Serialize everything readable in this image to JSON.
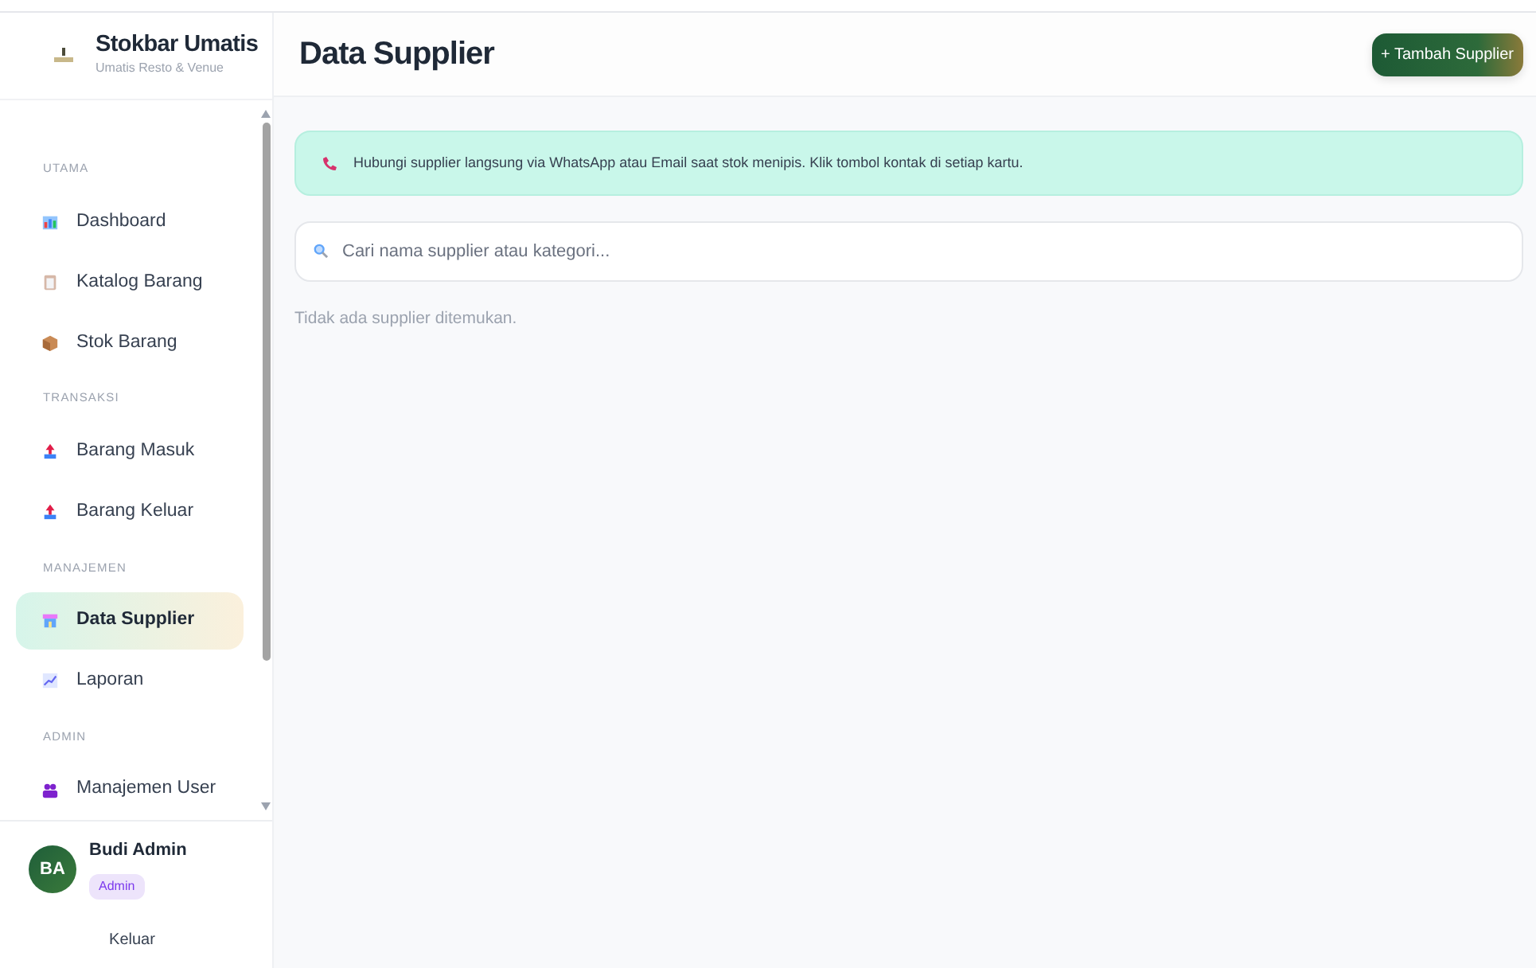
{
  "brand": {
    "title": "Stokbar Umatis",
    "subtitle": "Umatis Resto & Venue"
  },
  "nav": [
    {
      "kind": "section",
      "label": "UTAMA"
    },
    {
      "kind": "item",
      "label": "Dashboard",
      "selected": false
    },
    {
      "kind": "item",
      "label": "Katalog Barang",
      "selected": false
    },
    {
      "kind": "item",
      "label": "Stok Barang",
      "selected": false
    },
    {
      "kind": "section",
      "label": "TRANSAKSI"
    },
    {
      "kind": "item",
      "label": "Barang Masuk",
      "selected": false
    },
    {
      "kind": "item",
      "label": "Barang Keluar",
      "selected": false
    },
    {
      "kind": "section",
      "label": "MANAJEMEN"
    },
    {
      "kind": "item",
      "label": "Data Supplier",
      "selected": true
    },
    {
      "kind": "item",
      "label": "Laporan",
      "selected": false
    },
    {
      "kind": "section",
      "label": "ADMIN"
    },
    {
      "kind": "item",
      "label": "Manajemen User",
      "selected": false
    }
  ],
  "user": {
    "initials": "BA",
    "name": "Budi Admin",
    "role": "Admin",
    "logout": "Keluar"
  },
  "page": {
    "title": "Data Supplier",
    "add_button": "+ Tambah Supplier",
    "notice": "Hubungi supplier langsung via WhatsApp atau Email saat stok menipis. Klik tombol kontak di setiap kartu.",
    "search": {
      "placeholder": "Cari nama supplier atau kategori..."
    },
    "empty": "Tidak ada supplier ditemukan."
  }
}
